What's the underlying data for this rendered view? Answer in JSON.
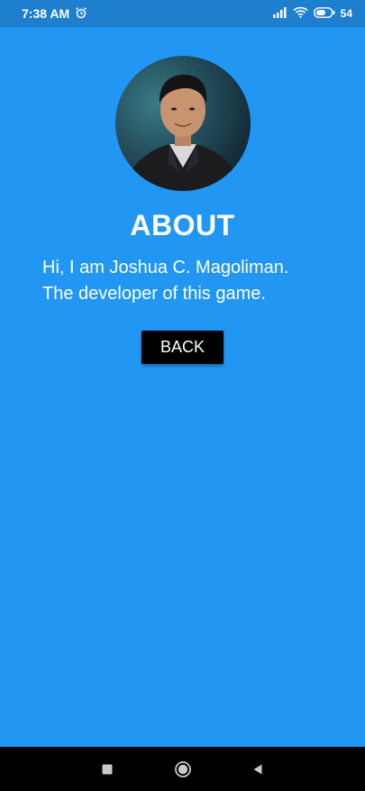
{
  "status_bar": {
    "time": "7:38 AM",
    "battery": "54",
    "icons": [
      "alarm-icon",
      "signal-icon",
      "wifi-icon",
      "battery-icon"
    ]
  },
  "about": {
    "title": "ABOUT",
    "bio_line_1": "Hi, I am Joshua C. Magoliman.",
    "bio_line_2": "The developer of this game.",
    "back_label": "BACK"
  },
  "nav_bar": {
    "icons": [
      "recent-apps-icon",
      "home-icon",
      "back-icon"
    ]
  },
  "colors": {
    "background": "#2196f3",
    "status_bar": "#1e7fcf",
    "button": "#000000",
    "text": "#ffffff"
  }
}
